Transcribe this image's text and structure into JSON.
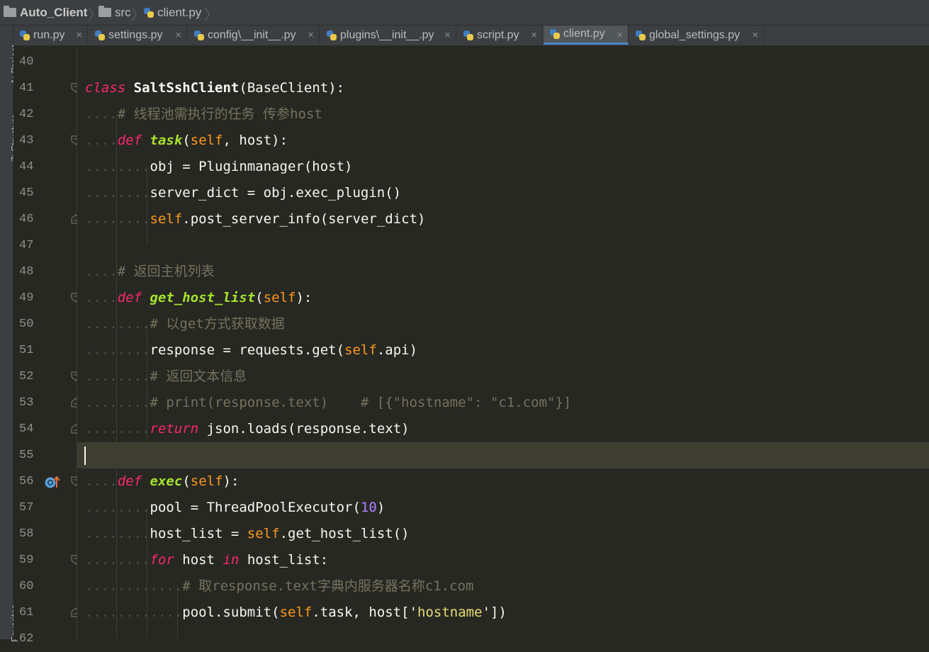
{
  "breadcrumb": {
    "project": "Auto_Client",
    "folder": "src",
    "file": "client.py"
  },
  "sidebar": {
    "tabs": [
      "1: Project",
      "7: Structure",
      "Favorites"
    ]
  },
  "tabs": [
    {
      "label": "run.py",
      "active": false
    },
    {
      "label": "settings.py",
      "active": false
    },
    {
      "label": "config\\__init__.py",
      "active": false
    },
    {
      "label": "plugins\\__init__.py",
      "active": false
    },
    {
      "label": "script.py",
      "active": false
    },
    {
      "label": "client.py",
      "active": true
    },
    {
      "label": "global_settings.py",
      "active": false
    }
  ],
  "tab_close_glyph": "×",
  "colors": {
    "keyword": "#f92672",
    "function": "#a6e22e",
    "self": "#fd971f",
    "comment": "#75715e",
    "number": "#ae81ff",
    "string": "#e6db74",
    "background": "#272822"
  },
  "editor": {
    "current_line": 55,
    "lines": [
      {
        "n": "40",
        "dots": "",
        "tokens": []
      },
      {
        "n": "41",
        "dots": "",
        "tokens": [
          {
            "t": "class",
            "c": "k"
          },
          {
            "t": " "
          },
          {
            "t": "SaltSshClient",
            "c": "cls"
          },
          {
            "t": "(BaseClient):"
          }
        ],
        "fold": "open"
      },
      {
        "n": "42",
        "dots": "....",
        "tokens": [
          {
            "t": "# 线程池需执行的任务 传参host",
            "c": "cm"
          }
        ]
      },
      {
        "n": "43",
        "dots": "....",
        "tokens": [
          {
            "t": "def",
            "c": "k"
          },
          {
            "t": " "
          },
          {
            "t": "task",
            "c": "fn"
          },
          {
            "t": "("
          },
          {
            "t": "self",
            "c": "self"
          },
          {
            "t": ", host):"
          }
        ],
        "fold": "open"
      },
      {
        "n": "44",
        "dots": "........",
        "tokens": [
          {
            "t": "obj = Pluginmanager(host)"
          }
        ]
      },
      {
        "n": "45",
        "dots": "........",
        "tokens": [
          {
            "t": "server_dict = obj.exec_plugin()"
          }
        ]
      },
      {
        "n": "46",
        "dots": "........",
        "tokens": [
          {
            "t": "self",
            "c": "self"
          },
          {
            "t": ".post_server_info(server_dict)"
          }
        ],
        "fold": "close"
      },
      {
        "n": "47",
        "dots": "",
        "tokens": []
      },
      {
        "n": "48",
        "dots": "....",
        "tokens": [
          {
            "t": "# 返回主机列表",
            "c": "cm"
          }
        ]
      },
      {
        "n": "49",
        "dots": "....",
        "tokens": [
          {
            "t": "def",
            "c": "k"
          },
          {
            "t": " "
          },
          {
            "t": "get_host_list",
            "c": "fn"
          },
          {
            "t": "("
          },
          {
            "t": "self",
            "c": "self"
          },
          {
            "t": "):"
          }
        ],
        "fold": "open"
      },
      {
        "n": "50",
        "dots": "........",
        "tokens": [
          {
            "t": "# 以get方式获取数据",
            "c": "cm"
          }
        ]
      },
      {
        "n": "51",
        "dots": "........",
        "tokens": [
          {
            "t": "response = requests.get("
          },
          {
            "t": "self",
            "c": "self"
          },
          {
            "t": ".api)"
          }
        ]
      },
      {
        "n": "52",
        "dots": "........",
        "tokens": [
          {
            "t": "# 返回文本信息",
            "c": "cm"
          }
        ],
        "fold": "open"
      },
      {
        "n": "53",
        "dots": "........",
        "tokens": [
          {
            "t": "# print(response.text)    # [{\"hostname\": \"c1.com\"}]",
            "c": "cm"
          }
        ],
        "fold": "close"
      },
      {
        "n": "54",
        "dots": "........",
        "tokens": [
          {
            "t": "return",
            "c": "k"
          },
          {
            "t": " json.loads(response.text)"
          }
        ],
        "fold": "close"
      },
      {
        "n": "55",
        "dots": "",
        "tokens": [],
        "caret": true
      },
      {
        "n": "56",
        "dots": "....",
        "tokens": [
          {
            "t": "def",
            "c": "k"
          },
          {
            "t": " "
          },
          {
            "t": "exec",
            "c": "fn"
          },
          {
            "t": "("
          },
          {
            "t": "self",
            "c": "self"
          },
          {
            "t": "):"
          }
        ],
        "fold": "open",
        "override": true
      },
      {
        "n": "57",
        "dots": "........",
        "tokens": [
          {
            "t": "pool = ThreadPoolExecutor("
          },
          {
            "t": "10",
            "c": "num"
          },
          {
            "t": ")"
          }
        ]
      },
      {
        "n": "58",
        "dots": "........",
        "tokens": [
          {
            "t": "host_list = "
          },
          {
            "t": "self",
            "c": "self"
          },
          {
            "t": ".get_host_list()"
          }
        ]
      },
      {
        "n": "59",
        "dots": "........",
        "tokens": [
          {
            "t": "for",
            "c": "k"
          },
          {
            "t": " host "
          },
          {
            "t": "in",
            "c": "k"
          },
          {
            "t": " host_list:"
          }
        ],
        "fold": "open"
      },
      {
        "n": "60",
        "dots": "............",
        "tokens": [
          {
            "t": "# 取response.text字典内服务器名称c1.com",
            "c": "cm"
          }
        ]
      },
      {
        "n": "61",
        "dots": "............",
        "tokens": [
          {
            "t": "pool.submit("
          },
          {
            "t": "self",
            "c": "self"
          },
          {
            "t": ".task, host['"
          },
          {
            "t": "hostname",
            "c": "str"
          },
          {
            "t": "'])"
          }
        ],
        "fold": "close"
      },
      {
        "n": "62",
        "dots": "",
        "tokens": []
      }
    ]
  }
}
